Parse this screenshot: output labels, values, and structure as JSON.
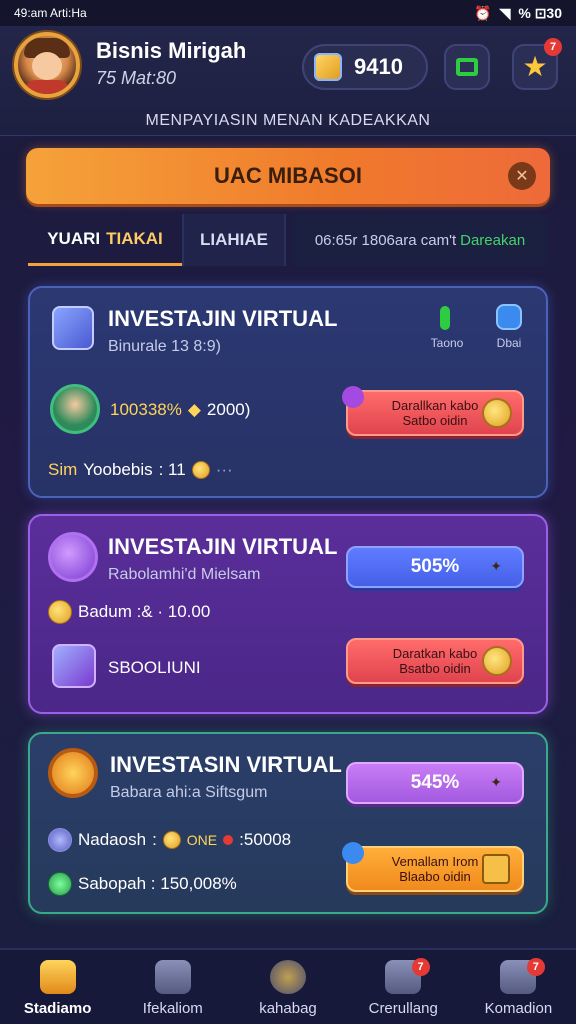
{
  "status_bar": {
    "left_text": "49:am Arti:Ha",
    "right_text": "% ⊡30"
  },
  "header": {
    "user_name": "Bisnis Mirigah",
    "user_sub": "75 Mat:80",
    "coin_value": "9410",
    "star_badge": "7",
    "subtitle": "MENPAYIASIN MENAN KADEAKKAN"
  },
  "banner": {
    "label": "UAC MIBASOI"
  },
  "tabs": [
    {
      "label_a": "YUARI",
      "label_b": "TIAKAI"
    },
    {
      "label": "LIAHIAE"
    },
    {
      "label": "06:65r 1806ara cam't",
      "label_green": "Dareakan"
    }
  ],
  "cards": [
    {
      "title": "INVESTAJIN VIRTUAL",
      "sub": "Binurale 13 8:9)",
      "row_value": "100338%",
      "row_extra": "2000)",
      "footer_label": "Sim",
      "footer_text": "Yoobebis",
      "footer_value": ": 11",
      "icon_labels": [
        "Taono",
        "Dbai"
      ],
      "button": {
        "line1": "Darallkan kabo",
        "line2": "Satbo oidin"
      }
    },
    {
      "title": "INVESTAJIN VIRTUAL",
      "sub": "Rabolamhi'd Mielsam",
      "row_text": "Badum :& · 10.00",
      "row2_text": "SBOOLIUNI",
      "pct": "505%",
      "button": {
        "line1": "Daratkan kabo",
        "line2": "Bsatbo oidin"
      }
    },
    {
      "title": "INVESTASIN VIRTUAL",
      "sub": "Babara ahi:a Siftsgum",
      "row_label": "Nadaosh",
      "row_mid": "ONE",
      "row_value": ":50008",
      "row2_text": "Sabopah : 150,008%",
      "pct": "545%",
      "button": {
        "line1": "Vemallam Irom",
        "line2": "Blaabo oidin"
      }
    }
  ],
  "bottom_nav": [
    {
      "label": "Stadiamo",
      "active": true
    },
    {
      "label": "Ifekaliom"
    },
    {
      "label": "kahabag"
    },
    {
      "label": "Crerullang",
      "badge": "7"
    },
    {
      "label": "Komadion",
      "badge": "7"
    }
  ],
  "colors": {
    "accent_orange": "#f5a23a",
    "tab_active": "#ffcb63",
    "green_text": "#43d36a"
  }
}
